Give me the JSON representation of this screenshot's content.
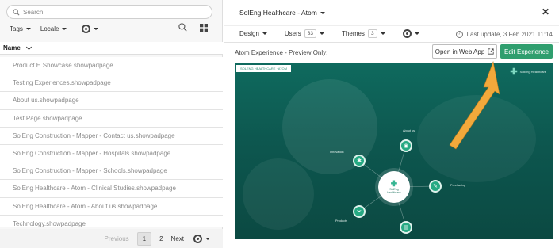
{
  "left_panel": {
    "search_placeholder": "Search",
    "filters": {
      "tags_label": "Tags",
      "locale_label": "Locale"
    },
    "column_header": "Name",
    "rows": [
      "Product H Showcase.showpadpage",
      "Testing Experiences.showpadpage",
      "About us.showpadpage",
      "Test Page.showpadpage",
      "SolEng Construction - Mapper - Contact us.showpadpage",
      "SolEng Construction - Mapper - Hospitals.showpadpage",
      "SolEng Construction - Mapper - Schools.showpadpage",
      "SolEng Healthcare - Atom - Clinical Studies.showpadpage",
      "SolEng Healthcare - Atom - About us.showpadpage",
      "Technology.showpadpage"
    ],
    "pagination": {
      "previous": "Previous",
      "pages": [
        "1",
        "2"
      ],
      "current": "1",
      "next": "Next"
    }
  },
  "right_panel": {
    "title": "SolEng Healthcare - Atom",
    "tabs": {
      "design": "Design",
      "users": "Users",
      "users_count": "33",
      "themes": "Themes",
      "themes_count": "3"
    },
    "last_update": "Last update, 3 Feb 2021 11:14",
    "preview_label": "Atom Experience - Preview Only:",
    "open_web_app": "Open in Web App",
    "edit_experience": "Edit Experience",
    "preview": {
      "tag": "SOLENG HEALTHCARE · ATOM",
      "logo_text": "SolEng Healthcare",
      "hub_line1": "SolEng",
      "hub_line2": "Healthcare",
      "nodes": {
        "about": "About us",
        "innovation": "Innovation",
        "purchasing": "Purchasing",
        "products": "Products"
      }
    }
  },
  "colors": {
    "accent_green": "#2f9e6e",
    "arrow_orange": "#f2a93b",
    "preview_teal": "#0f6a5e"
  }
}
